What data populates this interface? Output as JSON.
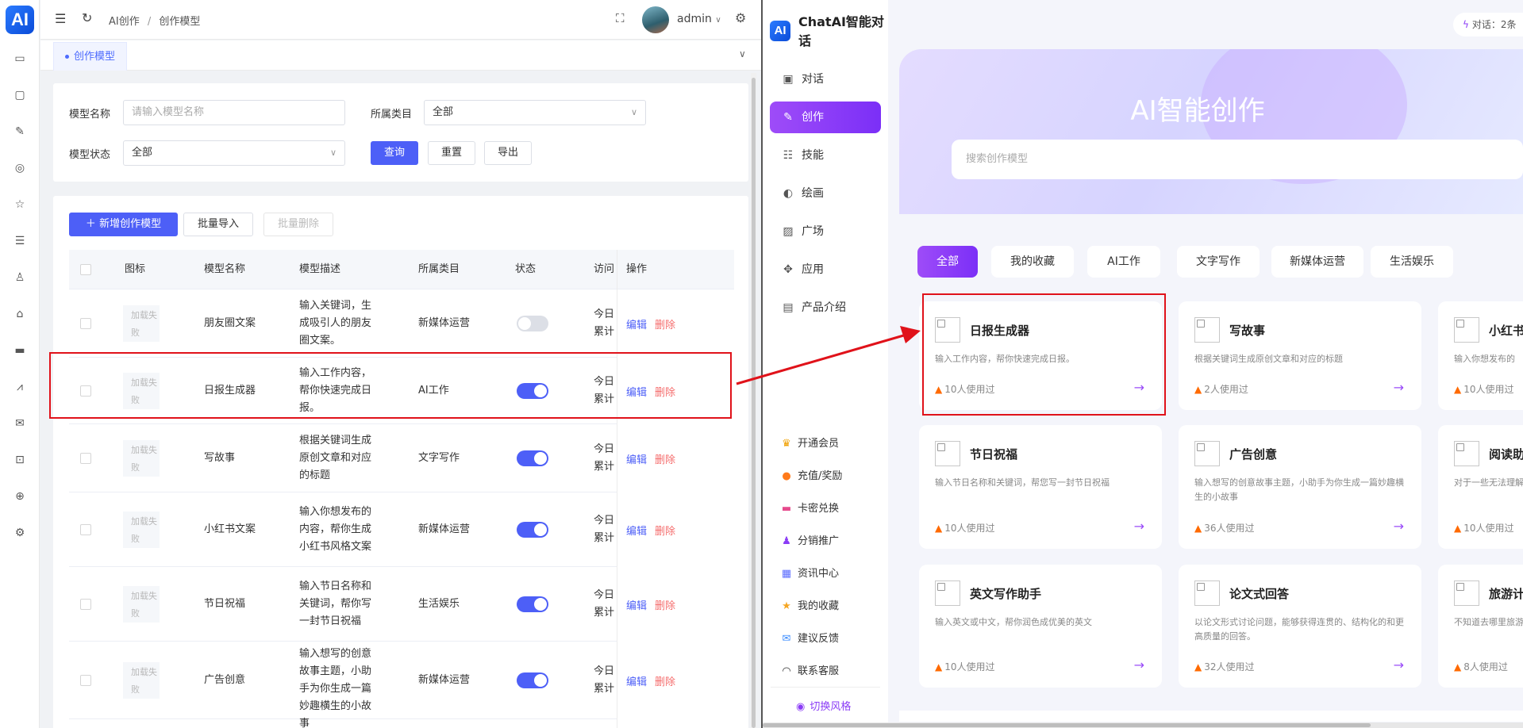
{
  "admin": {
    "logo": "AI",
    "rail_icons": [
      "monitor-icon",
      "chat-icon",
      "pen-icon",
      "compass-icon",
      "star-icon",
      "database-icon",
      "user-icon",
      "app-icon",
      "briefcase-icon",
      "chart-icon",
      "mail-icon",
      "lock-icon",
      "target-icon",
      "gear-icon"
    ],
    "breadcrumb": {
      "root": "AI创作",
      "sep": "/",
      "current": "创作模型"
    },
    "user": "admin",
    "tab": "创作模型",
    "filter": {
      "name_label": "模型名称",
      "name_placeholder": "请输入模型名称",
      "category_label": "所属类目",
      "category_value": "全部",
      "status_label": "模型状态",
      "status_value": "全部",
      "query_btn": "查询",
      "reset_btn": "重置",
      "export_btn": "导出"
    },
    "actions": {
      "add": "新增创作模型",
      "import": "批量导入",
      "batch_delete": "批量删除"
    },
    "table": {
      "headers": {
        "icon": "图标",
        "name": "模型名称",
        "desc": "模型描述",
        "category": "所属类目",
        "status": "状态",
        "visits": "访问",
        "ops": "操作"
      },
      "img_fail": "加载失败",
      "edit": "编辑",
      "delete": "删除",
      "visits_l1": "今日",
      "visits_l2": "累计",
      "rows": [
        {
          "name": "朋友圈文案",
          "desc": "输入关键词，生成吸引人的朋友圈文案。",
          "category": "新媒体运营",
          "enabled": false
        },
        {
          "name": "日报生成器",
          "desc": "输入工作内容，帮你快速完成日报。",
          "category": "AI工作",
          "enabled": true
        },
        {
          "name": "写故事",
          "desc": "根据关键词生成原创文章和对应的标题",
          "category": "文字写作",
          "enabled": true
        },
        {
          "name": "小红书文案",
          "desc": "输入你想发布的内容，帮你生成小红书风格文案",
          "category": "新媒体运营",
          "enabled": true
        },
        {
          "name": "节日祝福",
          "desc": "输入节日名称和关键词，帮你写一封节日祝福",
          "category": "生活娱乐",
          "enabled": true
        },
        {
          "name": "广告创意",
          "desc": "输入想写的创意故事主题，小助手为你生成一篇妙趣横生的小故事",
          "category": "新媒体运营",
          "enabled": true
        }
      ]
    }
  },
  "chat": {
    "logo": "AI",
    "title": "ChatAI智能对话",
    "top_right": "对话：2条",
    "nav": [
      {
        "label": "对话",
        "icon": "chat-icon"
      },
      {
        "label": "创作",
        "icon": "pen-icon"
      },
      {
        "label": "技能",
        "icon": "list-icon"
      },
      {
        "label": "绘画",
        "icon": "palette-icon"
      },
      {
        "label": "广场",
        "icon": "image-icon"
      },
      {
        "label": "应用",
        "icon": "grid-icon"
      },
      {
        "label": "产品介绍",
        "icon": "doc-icon"
      }
    ],
    "bottom_nav": [
      {
        "label": "开通会员",
        "icon": "vip-icon"
      },
      {
        "label": "充值/奖励",
        "icon": "coin-icon"
      },
      {
        "label": "卡密兑换",
        "icon": "card-icon"
      },
      {
        "label": "分销推广",
        "icon": "share-icon"
      },
      {
        "label": "资讯中心",
        "icon": "news-icon"
      },
      {
        "label": "我的收藏",
        "icon": "star-icon"
      },
      {
        "label": "建议反馈",
        "icon": "feedback-icon"
      },
      {
        "label": "联系客服",
        "icon": "headset-icon"
      }
    ],
    "switch_style": "切换风格",
    "hero_title": "AI智能创作",
    "search_placeholder": "搜索创作模型",
    "filters": [
      "全部",
      "我的收藏",
      "AI工作",
      "文字写作",
      "新媒体运营",
      "生活娱乐"
    ],
    "cards": [
      {
        "title": "日报生成器",
        "desc": "输入工作内容，帮你快速完成日报。",
        "uses": "10人使用过"
      },
      {
        "title": "写故事",
        "desc": "根据关键词生成原创文章和对应的标题",
        "uses": "2人使用过"
      },
      {
        "title": "小红书",
        "desc": "输入你想发布的",
        "uses": "10人使用过"
      },
      {
        "title": "节日祝福",
        "desc": "输入节日名称和关键词，帮您写一封节日祝福",
        "uses": "10人使用过"
      },
      {
        "title": "广告创意",
        "desc": "输入想写的创意故事主题，小助手为你生成一篇妙趣横生的小故事",
        "uses": "36人使用过"
      },
      {
        "title": "阅读助",
        "desc": "对于一些无法理解进行解读并制定",
        "uses": "10人使用过"
      },
      {
        "title": "英文写作助手",
        "desc": "输入英文或中文，帮你润色成优美的英文",
        "uses": "10人使用过"
      },
      {
        "title": "论文式回答",
        "desc": "以论文形式讨论问题，能够获得连贯的、结构化的和更高质量的回答。",
        "uses": "32人使用过"
      },
      {
        "title": "旅游计",
        "desc": "不知道去哪里旅游",
        "uses": "8人使用过"
      }
    ]
  }
}
